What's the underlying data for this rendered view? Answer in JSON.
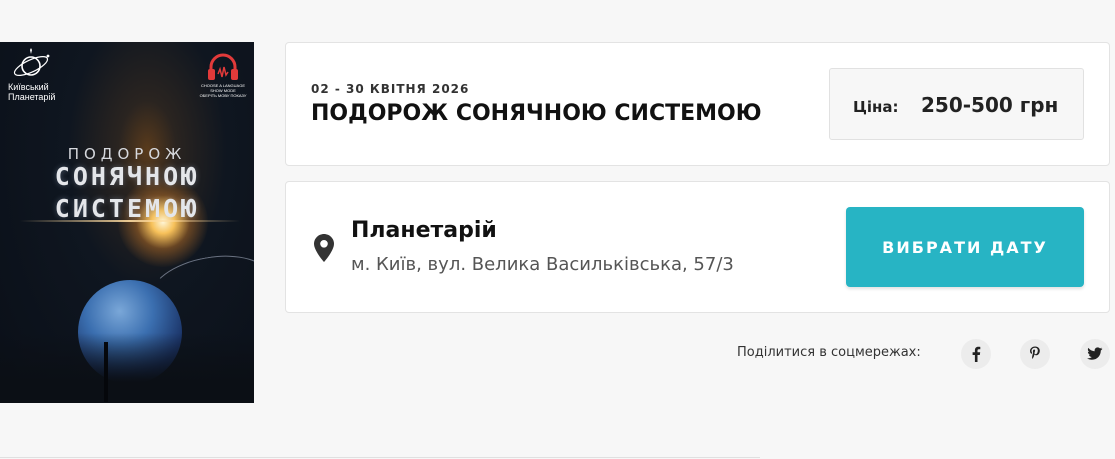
{
  "poster": {
    "logo_left": "Київський Планетарій",
    "logo_right_line1": "CHOOSE A LANGUAGE",
    "logo_right_line2": "SHOW MODE",
    "logo_right_line3": "ОБЕРІТЬ МОВУ ПОКАЗУ",
    "title_line1": "ПОДОРОЖ",
    "title_line2": "СОНЯЧНОЮ",
    "title_line3": "СИСТЕМОЮ"
  },
  "event": {
    "date_range": "02 - 30 КВІТНЯ 2026",
    "title": "ПОДОРОЖ СОНЯЧНОЮ СИСТЕМОЮ"
  },
  "price": {
    "label": "Ціна:",
    "value": "250-500 грн"
  },
  "venue": {
    "name": "Планетарій",
    "address": "м. Київ, вул. Велика Васильківська, 57/3",
    "icon": "map-pin-icon"
  },
  "actions": {
    "choose_date_label": "ВИБРАТИ ДАТУ",
    "accent_color": "#27b4c4"
  },
  "share": {
    "label": "Поділитися в соцмережах:",
    "networks": [
      "facebook-icon",
      "pinterest-icon",
      "twitter-icon"
    ]
  }
}
